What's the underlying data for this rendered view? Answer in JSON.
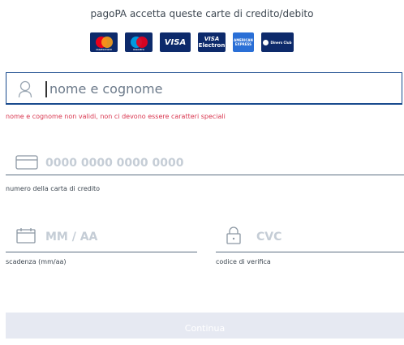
{
  "header": {
    "title": "pagoPA accetta queste carte di credito/debito"
  },
  "accepted_cards": [
    {
      "name": "mastercard",
      "label": "mastercard"
    },
    {
      "name": "maestro",
      "label": "maestro"
    },
    {
      "name": "visa",
      "label": "VISA"
    },
    {
      "name": "visa-electron",
      "label_top": "VISA",
      "label_bottom": "Electron"
    },
    {
      "name": "american-express",
      "label": "AMERICAN EXPRESS"
    },
    {
      "name": "diners-club",
      "label": "Diners Club"
    }
  ],
  "name_field": {
    "placeholder": "nome e cognome",
    "error": "nome e cognome non validi, non ci devono essere caratteri speciali"
  },
  "card_number_field": {
    "placeholder": "0000 0000 0000 0000",
    "label": "numero della carta di credito"
  },
  "expiry_field": {
    "placeholder": "MM / AA",
    "label": "scadenza (mm/aa)"
  },
  "cvc_field": {
    "placeholder": "CVC",
    "label": "codice di verifica"
  },
  "submit": {
    "label": "Continua"
  },
  "colors": {
    "primary": "#1a4b8e",
    "error": "#d9364f",
    "disabled_button": "#e6e9f2",
    "card_bg": "#0d2a6b"
  }
}
